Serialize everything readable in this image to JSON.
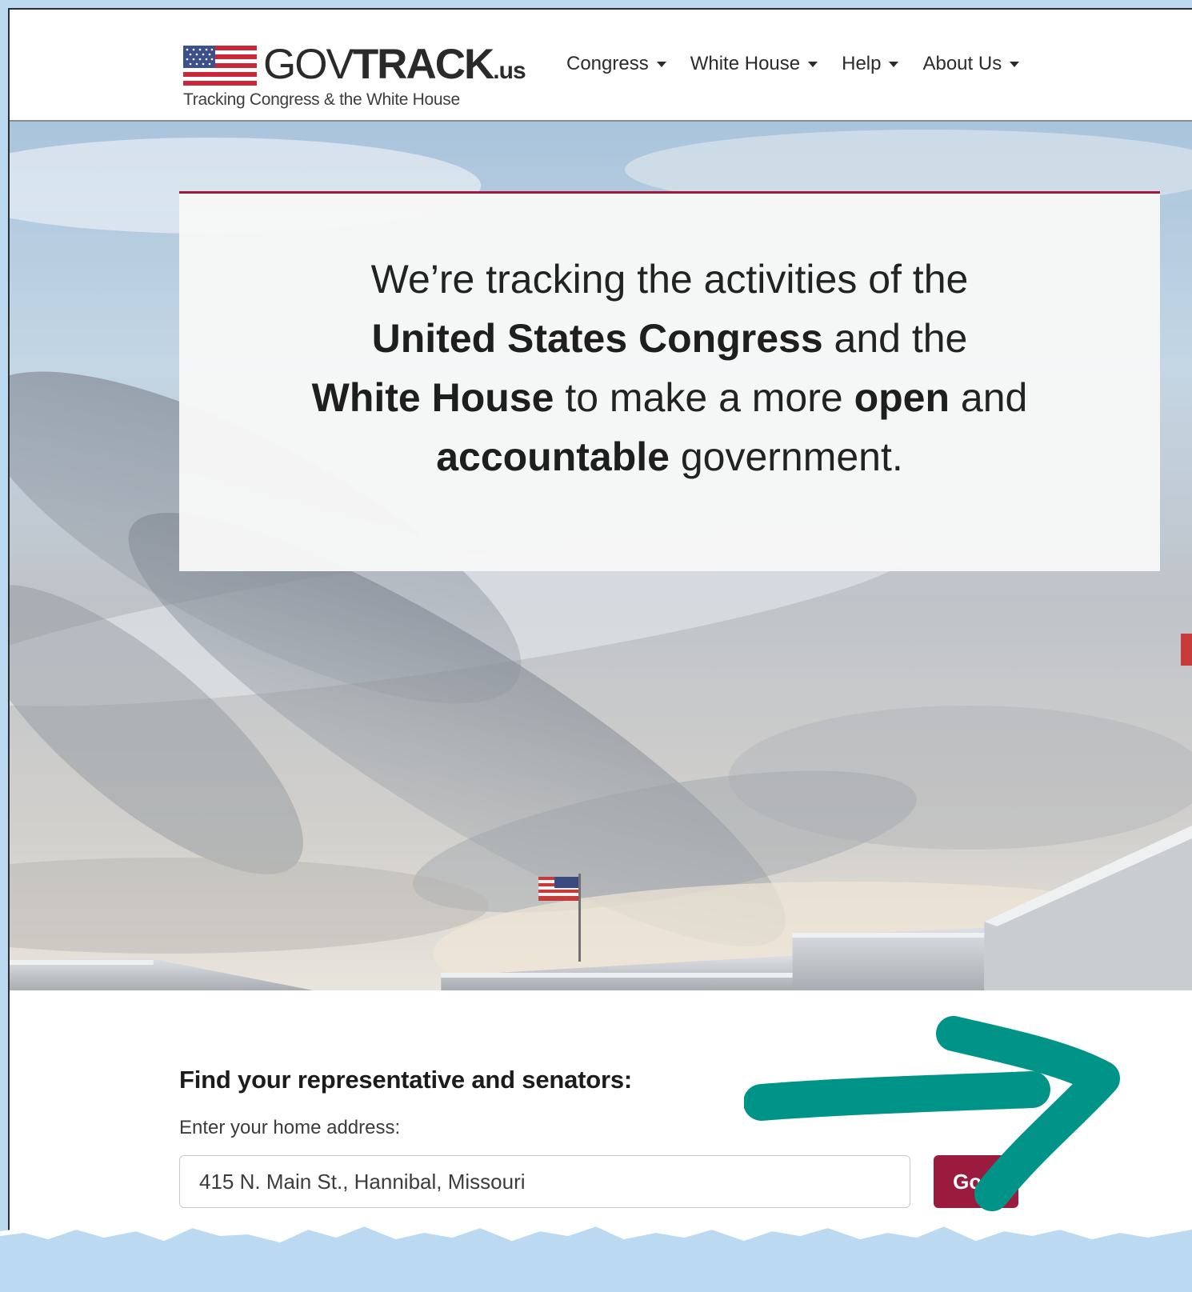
{
  "brand": {
    "wordmark_part1": "GOV",
    "wordmark_part2": "TRACK",
    "wordmark_part3": ".us",
    "tagline": "Tracking Congress & the White House"
  },
  "nav": {
    "items": [
      {
        "label": "Congress"
      },
      {
        "label": "White House"
      },
      {
        "label": "Help"
      },
      {
        "label": "About Us"
      }
    ]
  },
  "hero": {
    "line1": "We’re tracking the activities of the",
    "line2_bold": "United States Congress",
    "line2_rest": " and the",
    "line3_bold1": "White House",
    "line3_mid": " to make a more ",
    "line3_bold2": "open",
    "line3_end": " and",
    "line4_bold": "accountable",
    "line4_rest": " government."
  },
  "finder": {
    "heading": "Find your representative and senators:",
    "label": "Enter your home address:",
    "placeholder": "415 N. Main St., Hannibal, Missouri",
    "button_label": "Go »"
  },
  "colors": {
    "accent": "#9b1b3f",
    "annotation": "#009488",
    "frame_background": "#bcd9f2"
  },
  "icons": {
    "flag": "us-flag-icon",
    "caret": "caret-down-icon",
    "annotation": "arrow-right-icon"
  }
}
